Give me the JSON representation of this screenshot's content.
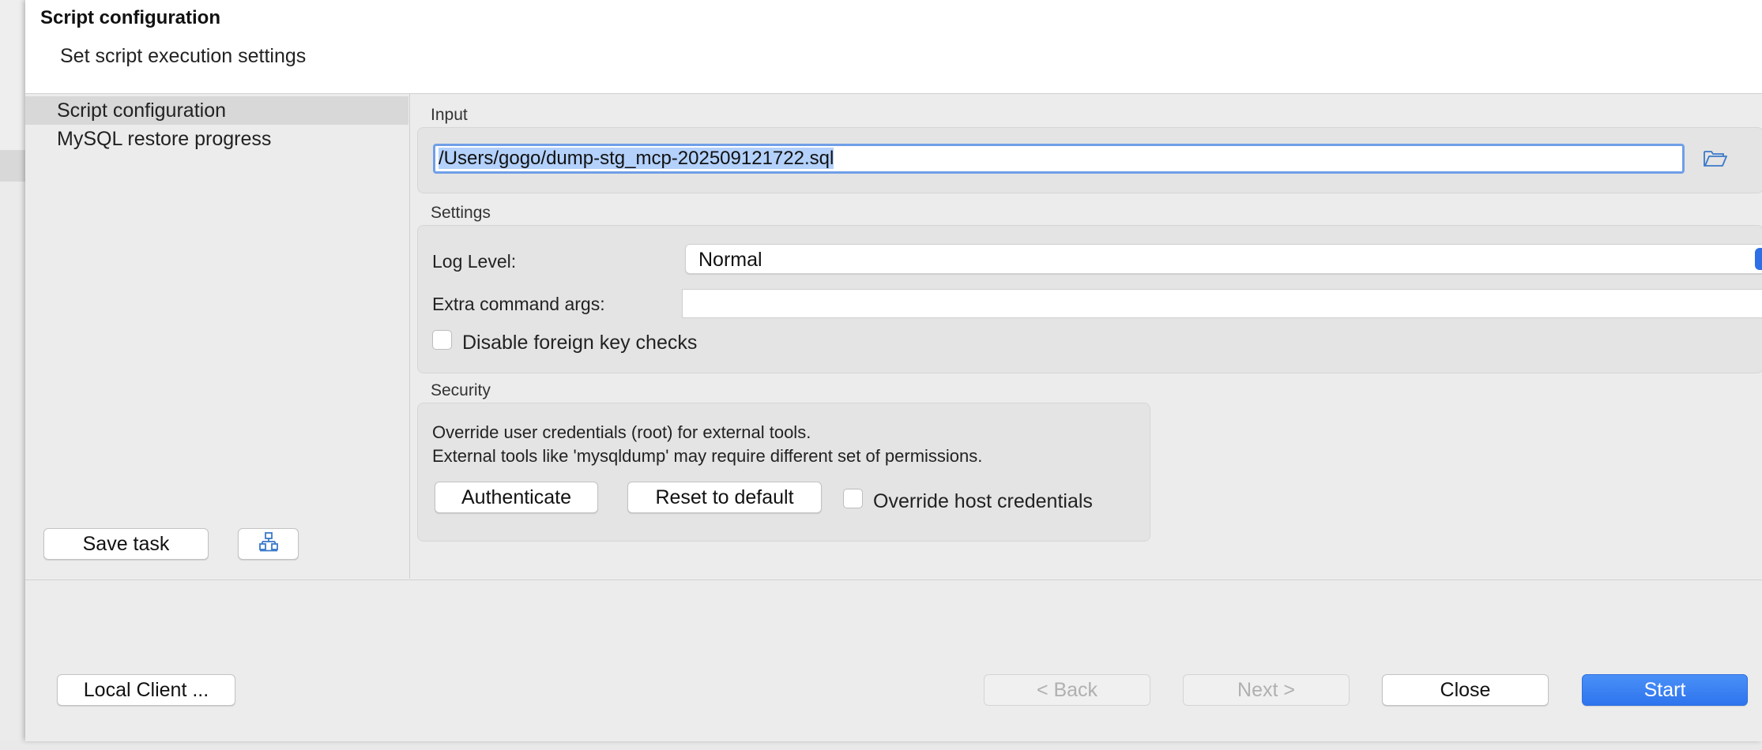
{
  "dialog": {
    "title": "Script configuration",
    "subtitle": "Set script execution settings"
  },
  "sidebar": {
    "items": [
      {
        "label": "Script configuration",
        "selected": true
      },
      {
        "label": "MySQL restore progress",
        "selected": false
      }
    ],
    "save_task_label": "Save task",
    "tasks_icon": "task-tree-icon"
  },
  "input_section": {
    "label": "Input",
    "file_path": "/Users/gogo/dump-stg_mcp-202509121722.sql",
    "browse_icon": "folder-open-icon"
  },
  "settings_section": {
    "label": "Settings",
    "log_level_label": "Log Level:",
    "log_level_value": "Normal",
    "extra_args_label": "Extra command args:",
    "extra_args_value": "",
    "disable_fk_label": "Disable foreign key checks",
    "disable_fk_checked": false
  },
  "security_section": {
    "label": "Security",
    "line1": "Override user credentials (root) for external tools.",
    "line2": "External tools like 'mysqldump' may require different set of permissions.",
    "authenticate_label": "Authenticate",
    "reset_label": "Reset to default",
    "override_host_label": "Override host credentials",
    "override_host_checked": false
  },
  "footer": {
    "local_client_label": "Local Client ...",
    "back_label": "< Back",
    "next_label": "Next >",
    "close_label": "Close",
    "start_label": "Start"
  },
  "colors": {
    "accent": "#2f6fe6",
    "selection": "#b3d1fb",
    "focus_ring": "#6f9fe8"
  }
}
